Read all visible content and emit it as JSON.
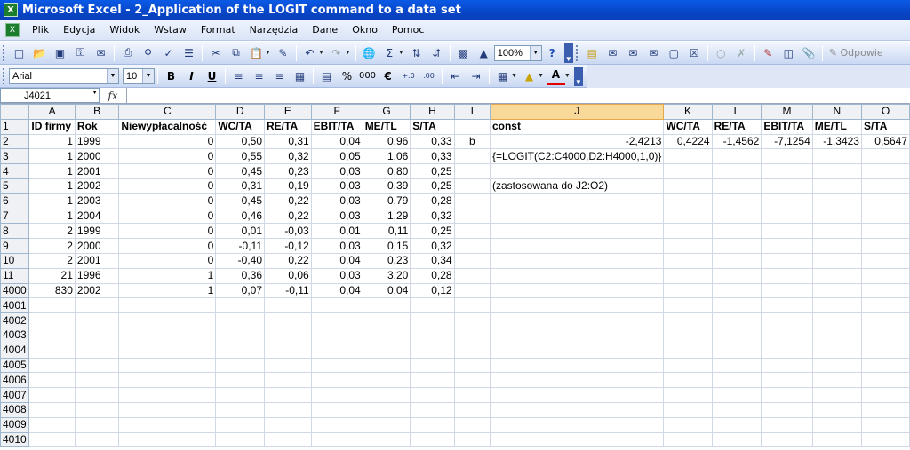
{
  "window": {
    "title": "Microsoft Excel - 2_Application of the LOGIT command to a data set",
    "app_icon": "excel-icon"
  },
  "menu": {
    "items": [
      "Plik",
      "Edycja",
      "Widok",
      "Wstaw",
      "Format",
      "Narzędzia",
      "Dane",
      "Okno",
      "Pomoc"
    ]
  },
  "toolbar": {
    "zoom": "100%",
    "font": "Arial",
    "font_size": "10",
    "bold": "B",
    "italic": "I",
    "underline": "U",
    "percent": "%",
    "thousands": "000",
    "euro": "€",
    "reply_label": "Odpowie"
  },
  "formula_bar": {
    "name_box": "J4021",
    "fx": "fx",
    "content": ""
  },
  "columns": [
    "A",
    "B",
    "C",
    "D",
    "E",
    "F",
    "G",
    "H",
    "I",
    "J",
    "K",
    "L",
    "M",
    "N",
    "O"
  ],
  "selected_column": "J",
  "rows": [
    {
      "n": "1",
      "c": [
        "ID firmy",
        "Rok",
        "Niewypłacalność",
        "WC/TA",
        "RE/TA",
        "EBIT/TA",
        "ME/TL",
        "S/TA",
        "",
        "const",
        "WC/TA",
        "RE/TA",
        "EBIT/TA",
        "ME/TL",
        "S/TA"
      ]
    },
    {
      "n": "2",
      "c": [
        "1",
        "1999",
        "0",
        "0,50",
        "0,31",
        "0,04",
        "0,96",
        "0,33",
        "b",
        "-2,4213",
        "0,4224",
        "-1,4562",
        "-7,1254",
        "-1,3423",
        "0,5647"
      ]
    },
    {
      "n": "3",
      "c": [
        "1",
        "2000",
        "0",
        "0,55",
        "0,32",
        "0,05",
        "1,06",
        "0,33",
        "",
        "{=LOGIT(C2:C4000,D2:H4000,1,0)}",
        "",
        "",
        "",
        "",
        ""
      ]
    },
    {
      "n": "4",
      "c": [
        "1",
        "2001",
        "0",
        "0,45",
        "0,23",
        "0,03",
        "0,80",
        "0,25",
        "",
        "",
        "",
        "",
        "",
        "",
        ""
      ]
    },
    {
      "n": "5",
      "c": [
        "1",
        "2002",
        "0",
        "0,31",
        "0,19",
        "0,03",
        "0,39",
        "0,25",
        "",
        "(zastosowana do J2:O2)",
        "",
        "",
        "",
        "",
        ""
      ]
    },
    {
      "n": "6",
      "c": [
        "1",
        "2003",
        "0",
        "0,45",
        "0,22",
        "0,03",
        "0,79",
        "0,28",
        "",
        "",
        "",
        "",
        "",
        "",
        ""
      ]
    },
    {
      "n": "7",
      "c": [
        "1",
        "2004",
        "0",
        "0,46",
        "0,22",
        "0,03",
        "1,29",
        "0,32",
        "",
        "",
        "",
        "",
        "",
        "",
        ""
      ]
    },
    {
      "n": "8",
      "c": [
        "2",
        "1999",
        "0",
        "0,01",
        "-0,03",
        "0,01",
        "0,11",
        "0,25",
        "",
        "",
        "",
        "",
        "",
        "",
        ""
      ]
    },
    {
      "n": "9",
      "c": [
        "2",
        "2000",
        "0",
        "-0,11",
        "-0,12",
        "0,03",
        "0,15",
        "0,32",
        "",
        "",
        "",
        "",
        "",
        "",
        ""
      ]
    },
    {
      "n": "10",
      "c": [
        "2",
        "2001",
        "0",
        "-0,40",
        "0,22",
        "0,04",
        "0,23",
        "0,34",
        "",
        "",
        "",
        "",
        "",
        "",
        ""
      ]
    },
    {
      "n": "11",
      "c": [
        "21",
        "1996",
        "1",
        "0,36",
        "0,06",
        "0,03",
        "3,20",
        "0,28",
        "",
        "",
        "",
        "",
        "",
        "",
        ""
      ]
    },
    {
      "n": "4000",
      "c": [
        "830",
        "2002",
        "1",
        "0,07",
        "-0,11",
        "0,04",
        "0,04",
        "0,12",
        "",
        "",
        "",
        "",
        "",
        "",
        ""
      ]
    },
    {
      "n": "4001",
      "c": [
        "",
        "",
        "",
        "",
        "",
        "",
        "",
        "",
        "",
        "",
        "",
        "",
        "",
        "",
        ""
      ]
    },
    {
      "n": "4002",
      "c": [
        "",
        "",
        "",
        "",
        "",
        "",
        "",
        "",
        "",
        "",
        "",
        "",
        "",
        "",
        ""
      ]
    },
    {
      "n": "4003",
      "c": [
        "",
        "",
        "",
        "",
        "",
        "",
        "",
        "",
        "",
        "",
        "",
        "",
        "",
        "",
        ""
      ]
    },
    {
      "n": "4004",
      "c": [
        "",
        "",
        "",
        "",
        "",
        "",
        "",
        "",
        "",
        "",
        "",
        "",
        "",
        "",
        ""
      ]
    },
    {
      "n": "4005",
      "c": [
        "",
        "",
        "",
        "",
        "",
        "",
        "",
        "",
        "",
        "",
        "",
        "",
        "",
        "",
        ""
      ]
    },
    {
      "n": "4006",
      "c": [
        "",
        "",
        "",
        "",
        "",
        "",
        "",
        "",
        "",
        "",
        "",
        "",
        "",
        "",
        ""
      ]
    },
    {
      "n": "4007",
      "c": [
        "",
        "",
        "",
        "",
        "",
        "",
        "",
        "",
        "",
        "",
        "",
        "",
        "",
        "",
        ""
      ]
    },
    {
      "n": "4008",
      "c": [
        "",
        "",
        "",
        "",
        "",
        "",
        "",
        "",
        "",
        "",
        "",
        "",
        "",
        "",
        ""
      ]
    },
    {
      "n": "4009",
      "c": [
        "",
        "",
        "",
        "",
        "",
        "",
        "",
        "",
        "",
        "",
        "",
        "",
        "",
        "",
        ""
      ]
    },
    {
      "n": "4010",
      "c": [
        "",
        "",
        "",
        "",
        "",
        "",
        "",
        "",
        "",
        "",
        "",
        "",
        "",
        "",
        ""
      ]
    }
  ]
}
